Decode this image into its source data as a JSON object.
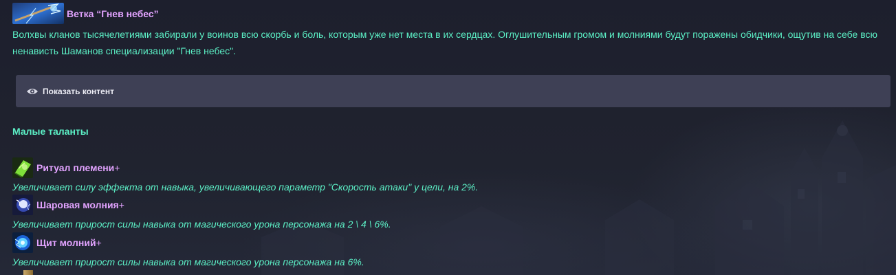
{
  "branch": {
    "icon": "lightning-staff-icon",
    "title": "Ветка “Гнев небес”",
    "description": "Волхвы кланов тысячелетиями забирали у воинов всю скорбь и боль, которым уже нет места в их сердцах. Оглушительным громом и молниями будут поражены обидчики, ощутив на себе всю ненависть Шаманов специализации \"Гнев небес\"."
  },
  "spoiler": {
    "icon": "eye-icon",
    "label": "Показать контент"
  },
  "minor_talents": {
    "title": "Малые таланты",
    "items": [
      {
        "icon": "green-tome-icon",
        "name": "Ритуал племени",
        "suffix": "+",
        "description": "Увеличивает силу эффекта от навыка, увеличивающего параметр \"Скорость атаки\" у цели, на 2%."
      },
      {
        "icon": "ball-lightning-icon",
        "name": "Шаровая молния",
        "suffix": "+",
        "description": "Увеличивает прирост силы навыка от магического урона персонажа на 2 \\ 4 \\ 6%."
      },
      {
        "icon": "lightning-shield-icon",
        "name": "Щит молний",
        "suffix": "+",
        "description": "Увеличивает прирост силы навыка от магического урона персонажа на 6%."
      }
    ]
  },
  "colors": {
    "background": "#1e2130",
    "accent_green": "#5cf0c6",
    "accent_pink": "#e2a3ff",
    "spoiler_bg": "#3e4055"
  }
}
